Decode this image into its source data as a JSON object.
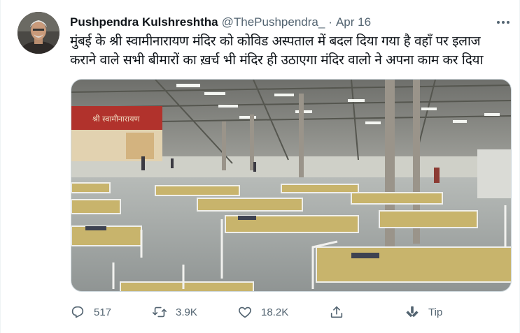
{
  "tweet": {
    "author_name": "Pushpendra Kulshreshtha",
    "handle": "@ThePushpendra_",
    "separator": "·",
    "date": "Apr 16",
    "text_line1": "मुंबई के श्री स्वामीनारायण मंदिर को कोविड अस्पताल में बदल दिया गया है वहाँ पर इलाज",
    "text_line2": "कराने वाले सभी बीमारों का ख़र्च भी मंदिर ही उठाएगा मंदिर वालो ने अपना काम कर दिया",
    "banner_text": "श्री स्वामीनारायण"
  },
  "actions": {
    "reply_count": "517",
    "retweet_count": "3.9K",
    "like_count": "18.2K",
    "tip_label": "Tip"
  },
  "icons": [
    "more-icon",
    "reply-icon",
    "retweet-icon",
    "like-icon",
    "share-icon",
    "tip-icon"
  ],
  "colors": {
    "text": "#0f1419",
    "secondary": "#536471",
    "border": "#cfd9de"
  }
}
